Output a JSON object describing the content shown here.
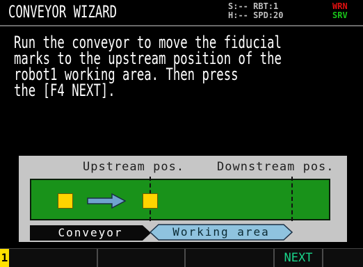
{
  "header": {
    "title": "CONVEYOR WIZARD",
    "status_line1": "S:-- RBT:1",
    "status_line2": "H:-- SPD:20",
    "wrn": "WRN",
    "srv": "SRV"
  },
  "message": "Run the conveyor to move the fiducial\nmarks to the upstream position of the\nrobot1 working area. Then press\nthe [F4 NEXT].",
  "diagram": {
    "upstream_label": "Upstream pos.",
    "downstream_label": "Downstream pos.",
    "conveyor_label": "Conveyor",
    "working_area_label": "Working area",
    "colors": {
      "belt": "#19921a",
      "fiducial": "#ffd400",
      "arrow": "#6fa3cf",
      "working_area": "#8fc3df"
    }
  },
  "function_keys": {
    "page": "1",
    "f1": "",
    "f2": "",
    "f3": "",
    "f4": "NEXT",
    "f5": ""
  }
}
